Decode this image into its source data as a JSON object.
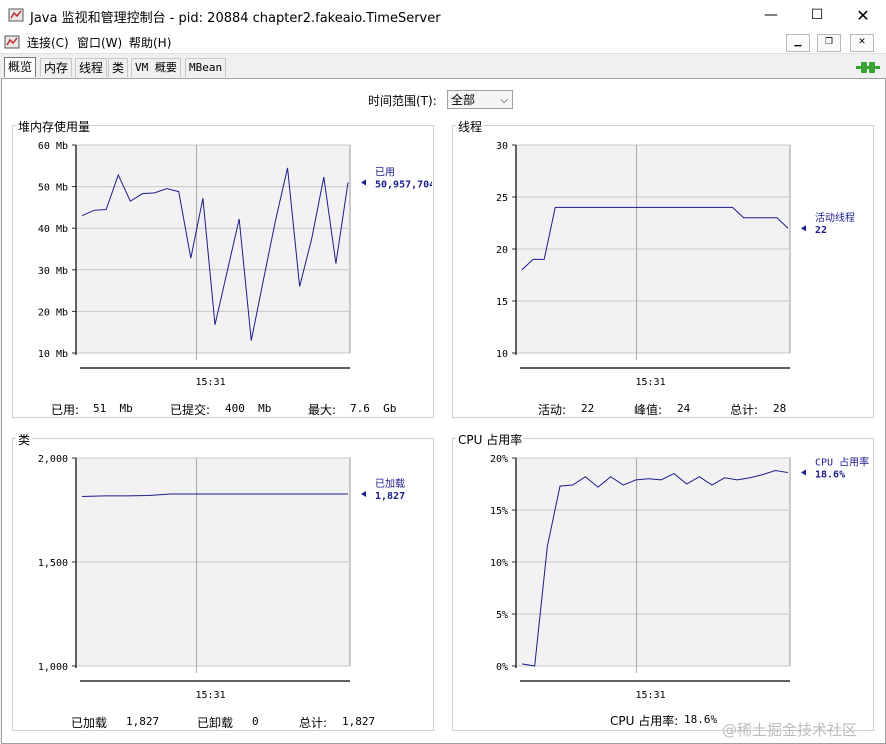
{
  "window": {
    "title": "Java 监视和管理控制台 - pid: 20884 chapter2.fakeaio.TimeServer",
    "minimize_icon": "minimize-icon",
    "maximize_icon": "maximize-icon",
    "close_icon": "close-icon"
  },
  "menu": {
    "items": [
      "连接(C)",
      "窗口(W)",
      "帮助(H)"
    ]
  },
  "tabs": [
    {
      "label": "概览",
      "active": true
    },
    {
      "label": "内存",
      "active": false
    },
    {
      "label": "线程",
      "active": false
    },
    {
      "label": "类",
      "active": false
    },
    {
      "label": "VM 概要",
      "active": false
    },
    {
      "label": "MBean",
      "active": false
    }
  ],
  "time_range": {
    "label": "时间范围(T):",
    "value": "全部"
  },
  "colors": {
    "line": "#1c1c8c",
    "grid": "#c8c8c8",
    "plot_bg": "#f2f2f2",
    "connected": "#3aa335"
  },
  "panels": {
    "heap": {
      "title": "堆内存使用量",
      "stats": {
        "used_label": "已用:",
        "used_value": "51  Mb",
        "committed_label": "已提交:",
        "committed_value": "400  Mb",
        "max_label": "最大:",
        "max_value": "7.6  Gb"
      },
      "chart_data": {
        "type": "line",
        "y_ticks": [
          "60 Mb",
          "50 Mb",
          "40 Mb",
          "30 Mb",
          "20 Mb",
          "10 Mb"
        ],
        "ylim": [
          10,
          60
        ],
        "x_tick": "15:31",
        "legend_name": "已用",
        "legend_value": "50,957,704",
        "series": [
          {
            "name": "已用",
            "values": [
              43,
              44.3,
              44.5,
              52.8,
              46.5,
              48.3,
              48.5,
              49.5,
              48.8,
              32.8,
              47.2,
              16.8,
              29.5,
              42.2,
              13,
              27.5,
              41.8,
              54.5,
              26,
              37.5,
              52.3,
              31.5,
              51
            ]
          }
        ]
      }
    },
    "threads": {
      "title": "线程",
      "stats": {
        "live_label": "活动:",
        "live_value": "22",
        "peak_label": "峰值:",
        "peak_value": "24",
        "total_label": "总计:",
        "total_value": "28"
      },
      "chart_data": {
        "type": "line",
        "y_ticks": [
          "30",
          "25",
          "20",
          "15",
          "10"
        ],
        "ylim": [
          10,
          30
        ],
        "x_tick": "15:31",
        "legend_name": "活动线程",
        "legend_value": "22",
        "series": [
          {
            "name": "活动线程",
            "values": [
              18,
              19,
              19,
              24,
              24,
              24,
              24,
              24,
              24,
              24,
              24,
              24,
              24,
              24,
              24,
              24,
              24,
              24,
              24,
              24,
              23,
              23,
              23,
              23,
              22
            ]
          }
        ]
      }
    },
    "classes": {
      "title": "类",
      "stats": {
        "loaded_label": "已加载",
        "loaded_value": "1,827",
        "unloaded_label": "已卸载",
        "unloaded_value": "0",
        "total_label": "总计:",
        "total_value": "1,827"
      },
      "chart_data": {
        "type": "line",
        "y_ticks": [
          "2,000",
          "1,500",
          "1,000"
        ],
        "ylim": [
          1000,
          2000
        ],
        "x_tick": "15:31",
        "legend_name": "已加载",
        "legend_value": "1,827",
        "series": [
          {
            "name": "已加载",
            "values": [
              1815,
              1818,
              1818,
              1820,
              1827,
              1827,
              1827,
              1827,
              1827,
              1827,
              1827,
              1827,
              1827
            ]
          }
        ]
      }
    },
    "cpu": {
      "title": "CPU 占用率",
      "stats": {
        "usage_label": "CPU 占用率:",
        "usage_value": "18.6%"
      },
      "chart_data": {
        "type": "line",
        "y_ticks": [
          "20%",
          "15%",
          "10%",
          "5%",
          "0%"
        ],
        "ylim": [
          0,
          20
        ],
        "x_tick": "15:31",
        "legend_name": "CPU 占用率",
        "legend_value": "18.6%",
        "series": [
          {
            "name": "CPU 占用率",
            "values": [
              0.2,
              0,
              11.5,
              17.3,
              17.4,
              18.2,
              17.2,
              18.2,
              17.4,
              17.9,
              18,
              17.9,
              18.5,
              17.5,
              18.2,
              17.4,
              18.1,
              17.9,
              18.1,
              18.4,
              18.8,
              18.6
            ]
          }
        ]
      }
    }
  },
  "watermark": "@稀土掘金技术社区"
}
